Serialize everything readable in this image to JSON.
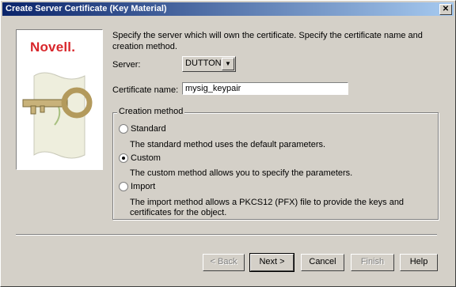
{
  "window": {
    "title": "Create Server Certificate (Key Material)",
    "close_label": "✕"
  },
  "logo": {
    "brand": "Novell."
  },
  "intro": "Specify the server which will own the certificate. Specify the certificate name and creation method.",
  "server": {
    "label": "Server:",
    "value": "DUTTON"
  },
  "certificate_name": {
    "label": "Certificate name:",
    "value": "mysig_keypair"
  },
  "creation_method": {
    "legend": "Creation method",
    "options": [
      {
        "label": "Standard",
        "description": "The standard method uses the default parameters.",
        "selected": false
      },
      {
        "label": "Custom",
        "description": "The custom method allows you to specify the parameters.",
        "selected": true
      },
      {
        "label": "Import",
        "description": "The import method allows a PKCS12 (PFX) file to provide the keys and certificates for the object.",
        "selected": false
      }
    ]
  },
  "buttons": {
    "back": "< Back",
    "next": "Next >",
    "cancel": "Cancel",
    "finish": "Finish",
    "help": "Help"
  },
  "colors": {
    "titlebar_start": "#0a246a",
    "brand_red": "#d8262b"
  }
}
